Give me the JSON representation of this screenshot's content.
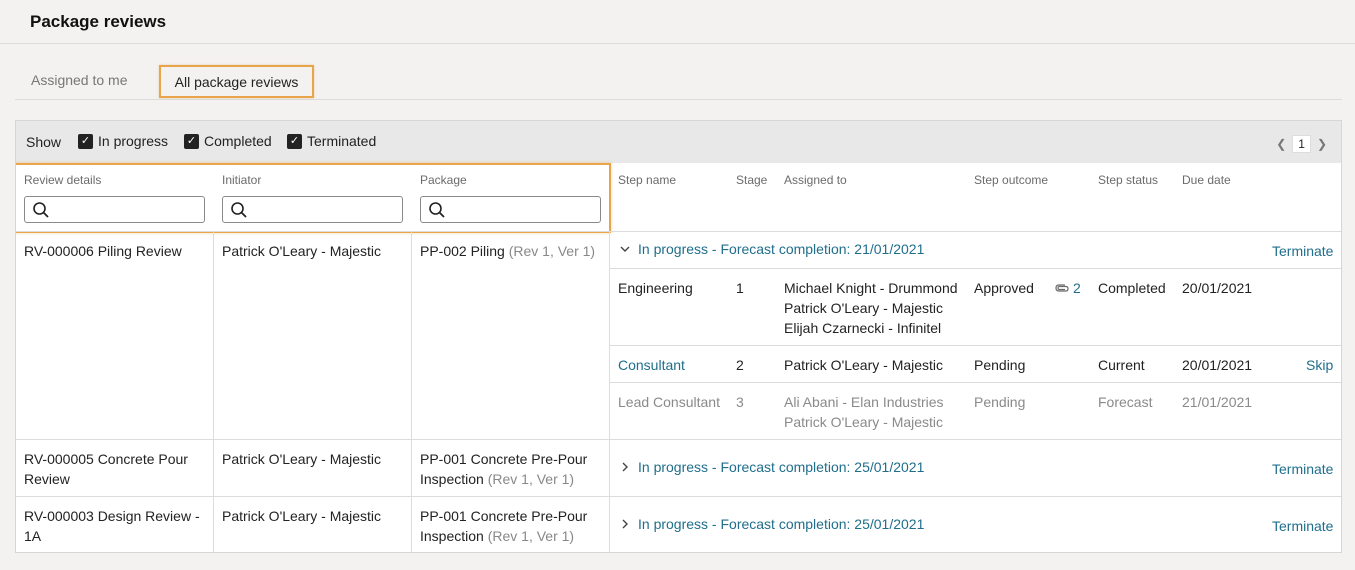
{
  "page": {
    "title": "Package reviews"
  },
  "tabs": [
    {
      "label": "Assigned to me"
    },
    {
      "label": "All package reviews"
    }
  ],
  "filters": {
    "show_label": "Show",
    "in_progress": "In progress",
    "completed": "Completed",
    "terminated": "Terminated"
  },
  "pager": {
    "page": "1"
  },
  "columns": {
    "review_details": "Review details",
    "initiator": "Initiator",
    "package": "Package",
    "step_name": "Step name",
    "stage": "Stage",
    "assigned_to": "Assigned to",
    "step_outcome": "Step outcome",
    "step_status": "Step status",
    "due_date": "Due date"
  },
  "reviews": [
    {
      "details": "RV-000006 Piling Review",
      "initiator": "Patrick O'Leary - Majestic",
      "package": "PP-002 Piling",
      "package_rev": "(Rev 1, Ver 1)",
      "status_line": "In progress - Forecast completion: 21/01/2021",
      "action": "Terminate",
      "steps": [
        {
          "name": "Engineering",
          "stage": "1",
          "assigned": [
            "Michael Knight - Drummond",
            "Patrick O'Leary - Majestic",
            "Elijah Czarnecki - Infinitel"
          ],
          "outcome": "Approved",
          "attachments": "2",
          "status": "Completed",
          "due": "20/01/2021"
        },
        {
          "name": "Consultant",
          "stage": "2",
          "assigned": [
            "Patrick O'Leary - Majestic"
          ],
          "outcome": "Pending",
          "status": "Current",
          "due": "20/01/2021",
          "action": "Skip"
        },
        {
          "name": "Lead Consultant",
          "stage": "3",
          "assigned": [
            "Ali Abani - Elan Industries",
            "Patrick O'Leary - Majestic"
          ],
          "outcome": "Pending",
          "status": "Forecast",
          "due": "21/01/2021"
        }
      ]
    },
    {
      "details_line1": "RV-000005 Concrete Pour",
      "details_line2": "Review",
      "initiator": "Patrick O'Leary - Majestic",
      "package_line1": "PP-001 Concrete Pre-Pour",
      "package_line2": "Inspection",
      "package_rev": "(Rev 1, Ver 1)",
      "status_line": "In progress - Forecast completion: 25/01/2021",
      "action": "Terminate"
    },
    {
      "details_line1": "RV-000003 Design Review -",
      "details_line2": "1A",
      "initiator": "Patrick O'Leary - Majestic",
      "package_line1": "PP-001 Concrete Pre-Pour",
      "package_line2": "Inspection",
      "package_rev": "(Rev 1, Ver 1)",
      "status_line": "In progress - Forecast completion: 25/01/2021",
      "action": "Terminate"
    }
  ],
  "colors": {
    "accent": "#1f6e8c",
    "highlight": "#e8a54b"
  }
}
